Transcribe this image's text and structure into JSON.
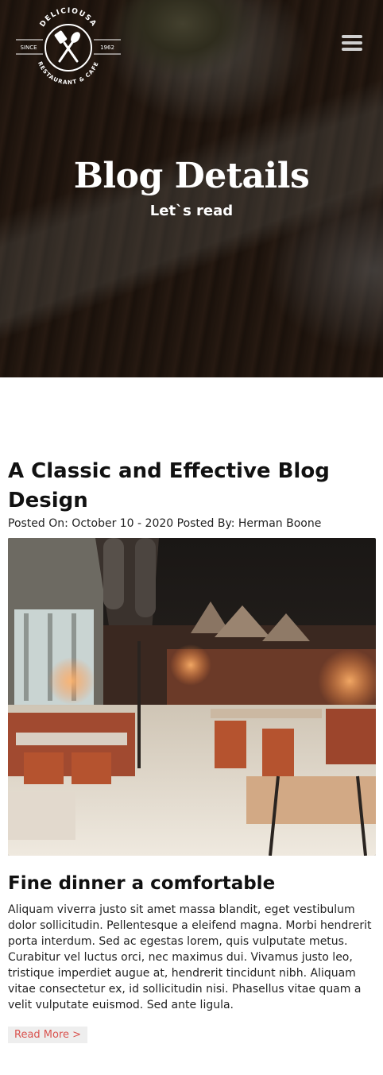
{
  "header": {
    "logo": {
      "brand": "DELICIOUSA",
      "since": "SINCE",
      "year": "1962",
      "tagline": "RESTAURANT & CAFE"
    },
    "title": "Blog Details",
    "subtitle": "Let`s read"
  },
  "post": {
    "title": "A Classic and Effective Blog Design",
    "meta": "Posted On: October 10 - 2020 Posted By: Herman Boone",
    "subtitle": "Fine dinner a comfortable",
    "body": "Aliquam viverra justo sit amet massa blandit, eget vestibulum dolor sollicitudin. Pellentesque a eleifend magna. Morbi hendrerit porta interdum. Sed ac egestas lorem, quis vulputate metus. Curabitur vel luctus orci, nec maximus dui. Vivamus justo leo, tristique imperdiet augue at, hendrerit tincidunt nibh. Aliquam vitae consectetur ex, id sollicitudin nisi. Phasellus vitae quam a velit vulputate euismod. Sed ante ligula.",
    "read_more": "Read More >"
  },
  "colors": {
    "read_more_text": "#d9534f",
    "read_more_bg": "#eeeeee"
  },
  "icons": {
    "menu": "hamburger-menu-icon",
    "logo_mark": "spoon-and-spatula-icon"
  }
}
